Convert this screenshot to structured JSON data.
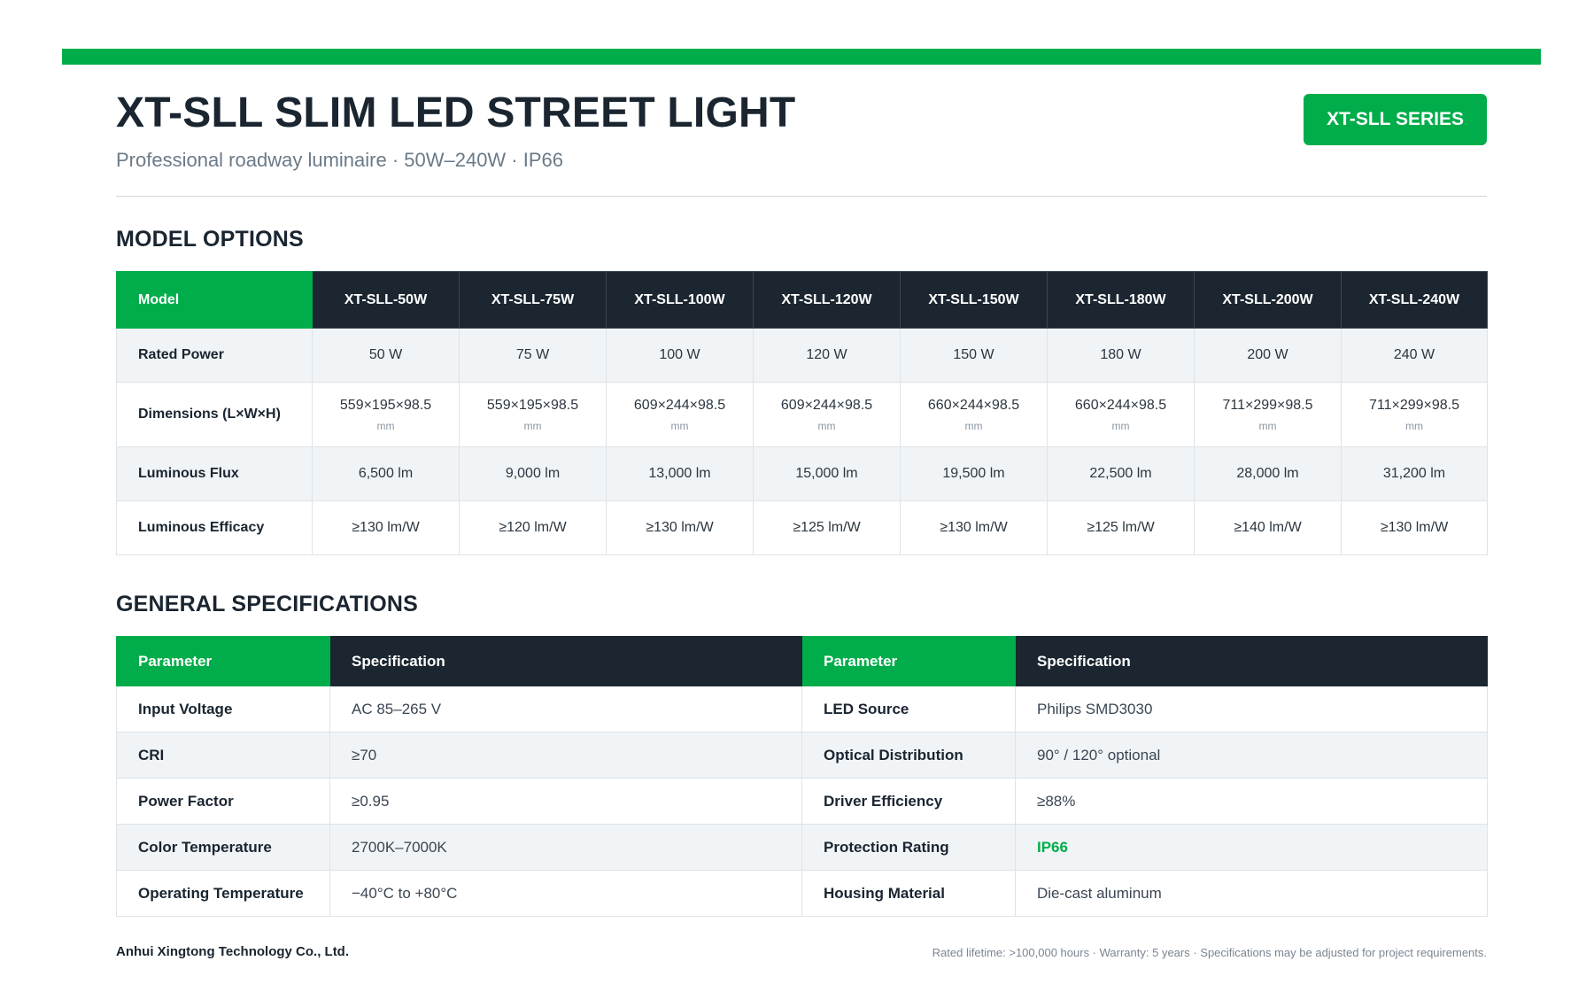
{
  "header": {
    "title": "XT-SLL SLIM LED STREET LIGHT",
    "subtitle": "Professional roadway luminaire · 50W–240W · IP66",
    "series_badge": "XT-SLL SERIES"
  },
  "colors": {
    "accent": "#00ad4a",
    "dark_header": "#1b2630",
    "row_alt": "#f1f4f6"
  },
  "model_options": {
    "section_title": "MODEL OPTIONS",
    "corner_label": "Model",
    "models": [
      "XT-SLL-50W",
      "XT-SLL-75W",
      "XT-SLL-100W",
      "XT-SLL-120W",
      "XT-SLL-150W",
      "XT-SLL-180W",
      "XT-SLL-200W",
      "XT-SLL-240W"
    ],
    "rows": {
      "rated_power": {
        "label": "Rated Power",
        "values": [
          "50 W",
          "75 W",
          "100 W",
          "120 W",
          "150 W",
          "180 W",
          "200 W",
          "240 W"
        ]
      },
      "dimensions": {
        "label": "Dimensions (L×W×H)",
        "values": [
          "559×195×98.5",
          "559×195×98.5",
          "609×244×98.5",
          "609×244×98.5",
          "660×244×98.5",
          "660×244×98.5",
          "711×299×98.5",
          "711×299×98.5"
        ],
        "unit": "mm"
      },
      "luminous_flux": {
        "label": "Luminous Flux",
        "values": [
          "6,500 lm",
          "9,000 lm",
          "13,000 lm",
          "15,000 lm",
          "19,500 lm",
          "22,500 lm",
          "28,000 lm",
          "31,200 lm"
        ]
      },
      "luminous_efficacy": {
        "label": "Luminous Efficacy",
        "values": [
          "≥130 lm/W",
          "≥120 lm/W",
          "≥130 lm/W",
          "≥125 lm/W",
          "≥130 lm/W",
          "≥125 lm/W",
          "≥140 lm/W",
          "≥130 lm/W"
        ]
      }
    }
  },
  "general_specs": {
    "section_title": "GENERAL SPECIFICATIONS",
    "headers": {
      "parameter": "Parameter",
      "specification": "Specification"
    },
    "rows": [
      {
        "left_param": "Input Voltage",
        "left_value": "AC 85–265 V",
        "right_param": "LED Source",
        "right_value": "Philips SMD3030"
      },
      {
        "left_param": "CRI",
        "left_value": "≥70",
        "right_param": "Optical Distribution",
        "right_value": "90° / 120° optional"
      },
      {
        "left_param": "Power Factor",
        "left_value": "≥0.95",
        "right_param": "Driver Efficiency",
        "right_value": "≥88%"
      },
      {
        "left_param": "Color Temperature",
        "left_value": "2700K–7000K",
        "right_param": "Protection Rating",
        "right_value": "IP66"
      },
      {
        "left_param": "Operating Temperature",
        "left_value": "−40°C to +80°C",
        "right_param": "Housing Material",
        "right_value": "Die-cast aluminum"
      }
    ]
  },
  "footer": {
    "company": "Anhui Xingtong Technology Co., Ltd.",
    "note": "Rated lifetime: >100,000 hours · Warranty: 5 years · Specifications may be adjusted for project requirements."
  }
}
